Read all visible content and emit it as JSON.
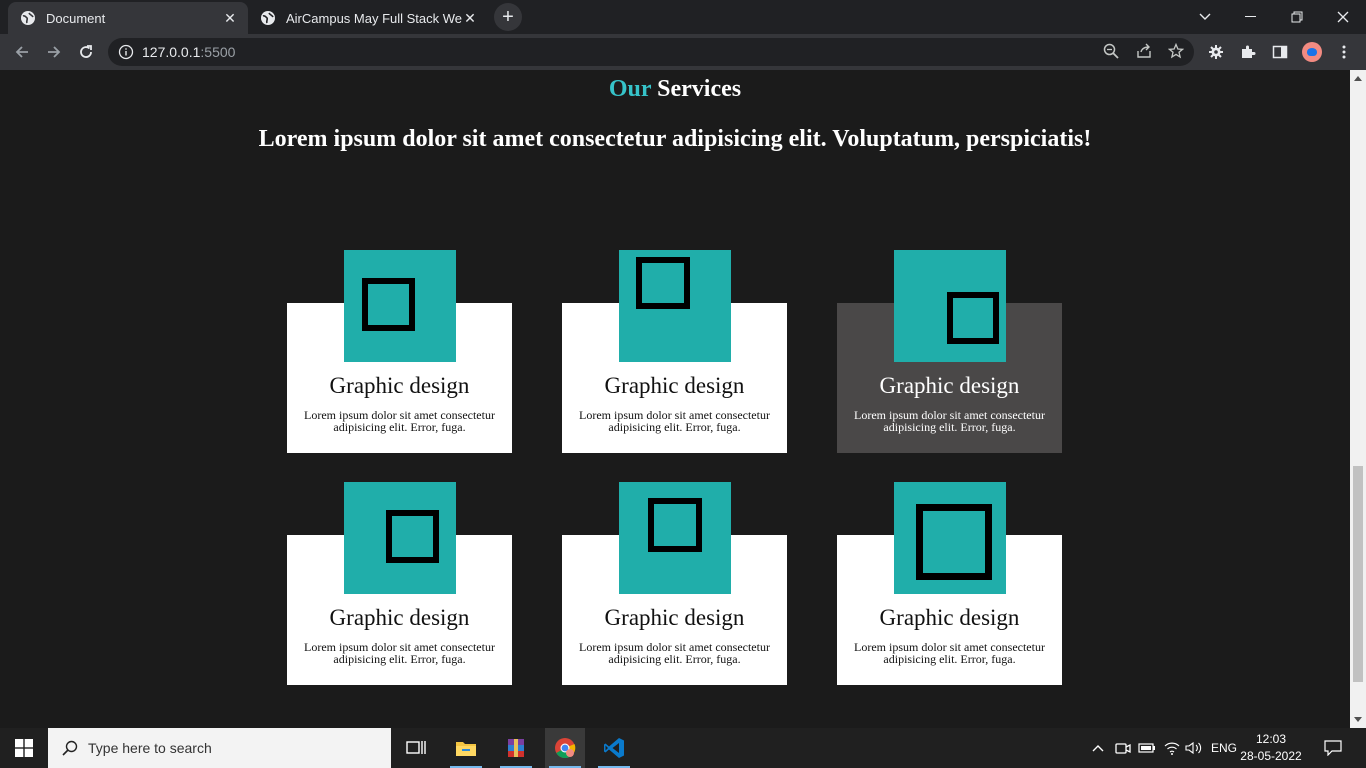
{
  "browser": {
    "tabs": [
      {
        "title": "Document",
        "active": true
      },
      {
        "title": "AirCampus May Full Stack Web D",
        "active": false
      }
    ],
    "url_host": "127.0.0.1",
    "url_port": ":5500"
  },
  "page": {
    "heading_accent": "Our",
    "heading_rest": " Services",
    "subheading": "Lorem ipsum dolor sit amet consectetur adipisicing elit. Voluptatum, perspiciatis!",
    "cards": [
      {
        "title": "Graphic design",
        "text": "Lorem ipsum dolor sit amet consectetur adipisicing elit. Error, fuga."
      },
      {
        "title": "Graphic design",
        "text": "Lorem ipsum dolor sit amet consectetur adipisicing elit. Error, fuga."
      },
      {
        "title": "Graphic design",
        "text": "Lorem ipsum dolor sit amet consectetur adipisicing elit. Error, fuga."
      },
      {
        "title": "Graphic design",
        "text": "Lorem ipsum dolor sit amet consectetur adipisicing elit. Error, fuga."
      },
      {
        "title": "Graphic design",
        "text": "Lorem ipsum dolor sit amet consectetur adipisicing elit. Error, fuga."
      },
      {
        "title": "Graphic design",
        "text": "Lorem ipsum dolor sit amet consectetur adipisicing elit. Error, fuga."
      }
    ]
  },
  "taskbar": {
    "search_placeholder": "Type here to search",
    "language": "ENG",
    "time": "12:03",
    "date": "28-05-2022"
  },
  "colors": {
    "accent": "#36c3c9",
    "teal_block": "#20aeaa",
    "page_bg": "#1b1b1b",
    "card_hover_bg": "#4a4848"
  }
}
